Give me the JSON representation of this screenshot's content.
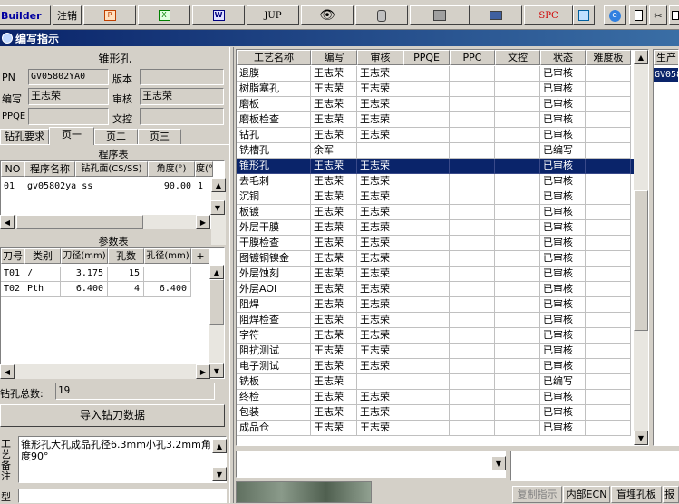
{
  "toolbar": {
    "builder_label": "Builder",
    "cancel_label": "注销",
    "jup_label": "JUP",
    "spc_label": "SPC"
  },
  "window": {
    "title": "编写指示"
  },
  "left": {
    "section_title": "锥形孔",
    "pn_label": "PN",
    "pn_value": "GV05802YA0",
    "version_label": "版本",
    "version_value": "",
    "writer_label": "编写",
    "writer_value": "王志荣",
    "reviewer_label": "审核",
    "reviewer_value": "王志荣",
    "ppqe_label": "PPQE",
    "ppqe_value": "",
    "doc_label": "文控",
    "doc_value": "",
    "tabs": [
      "钻孔要求",
      "页一",
      "页二",
      "页三"
    ],
    "program_table": {
      "title": "程序表",
      "headers": [
        "NO",
        "程序名称",
        "钻孔面(CS/SS)",
        "角度(°)",
        "度(°"
      ],
      "rows": [
        [
          "01",
          "gv05802ya ss",
          "",
          "90.00",
          "1"
        ]
      ]
    },
    "param_table": {
      "title": "参数表",
      "headers": [
        "刀号",
        "类别",
        "刀径(mm)",
        "孔数",
        "孔径(mm)",
        "+"
      ],
      "rows": [
        [
          "T01",
          "/",
          "3.175",
          "15",
          ""
        ],
        [
          "T02",
          "Pth",
          "6.400",
          "4",
          "6.400"
        ]
      ]
    },
    "total_label": "钻孔总数:",
    "total_value": "19",
    "import_button": "导入钻刀数据",
    "note_label": "工艺备注",
    "note_text": "锥形孔大孔成品孔径6.3mm小孔3.2mm角度90°",
    "type_label": "型"
  },
  "process_table": {
    "headers": [
      "工艺名称",
      "编写",
      "审核",
      "PPQE",
      "PPC",
      "文控",
      "状态",
      "难度板"
    ],
    "selected_index": 6,
    "rows": [
      [
        "退膜",
        "王志荣",
        "王志荣",
        "",
        "",
        "",
        "已审核",
        ""
      ],
      [
        "树脂塞孔",
        "王志荣",
        "王志荣",
        "",
        "",
        "",
        "已审核",
        ""
      ],
      [
        "磨板",
        "王志荣",
        "王志荣",
        "",
        "",
        "",
        "已审核",
        ""
      ],
      [
        "磨板检查",
        "王志荣",
        "王志荣",
        "",
        "",
        "",
        "已审核",
        ""
      ],
      [
        "钻孔",
        "王志荣",
        "王志荣",
        "",
        "",
        "",
        "已审核",
        ""
      ],
      [
        "铣槽孔",
        "余军",
        "",
        "",
        "",
        "",
        "已编写",
        ""
      ],
      [
        "锥形孔",
        "王志荣",
        "王志荣",
        "",
        "",
        "",
        "已审核",
        ""
      ],
      [
        "去毛刺",
        "王志荣",
        "王志荣",
        "",
        "",
        "",
        "已审核",
        ""
      ],
      [
        "沉铜",
        "王志荣",
        "王志荣",
        "",
        "",
        "",
        "已审核",
        ""
      ],
      [
        "板镀",
        "王志荣",
        "王志荣",
        "",
        "",
        "",
        "已审核",
        ""
      ],
      [
        "外层干膜",
        "王志荣",
        "王志荣",
        "",
        "",
        "",
        "已审核",
        ""
      ],
      [
        "干膜检查",
        "王志荣",
        "王志荣",
        "",
        "",
        "",
        "已审核",
        ""
      ],
      [
        "图镀铜镍金",
        "王志荣",
        "王志荣",
        "",
        "",
        "",
        "已审核",
        ""
      ],
      [
        "外层蚀刻",
        "王志荣",
        "王志荣",
        "",
        "",
        "",
        "已审核",
        ""
      ],
      [
        "外层AOI",
        "王志荣",
        "王志荣",
        "",
        "",
        "",
        "已审核",
        ""
      ],
      [
        "阻焊",
        "王志荣",
        "王志荣",
        "",
        "",
        "",
        "已审核",
        ""
      ],
      [
        "阻焊检查",
        "王志荣",
        "王志荣",
        "",
        "",
        "",
        "已审核",
        ""
      ],
      [
        "字符",
        "王志荣",
        "王志荣",
        "",
        "",
        "",
        "已审核",
        ""
      ],
      [
        "阻抗测试",
        "王志荣",
        "王志荣",
        "",
        "",
        "",
        "已审核",
        ""
      ],
      [
        "电子测试",
        "王志荣",
        "王志荣",
        "",
        "",
        "",
        "已审核",
        ""
      ],
      [
        "铣板",
        "王志荣",
        "",
        "",
        "",
        "",
        "已编写",
        ""
      ],
      [
        "终检",
        "王志荣",
        "王志荣",
        "",
        "",
        "",
        "已审核",
        ""
      ],
      [
        "包装",
        "王志荣",
        "王志荣",
        "",
        "",
        "",
        "已审核",
        ""
      ],
      [
        "成品仓",
        "王志荣",
        "王志荣",
        "",
        "",
        "",
        "已审核",
        ""
      ]
    ]
  },
  "right_panel": {
    "header": "生产",
    "value": "GV058"
  },
  "bottom_buttons": [
    "复制指示",
    "内部ECN",
    "盲埋孔板",
    "报"
  ],
  "colors": {
    "selected_bg": "#0a246a",
    "title_bg": "#0a246a",
    "window_bg": "#d4d0c8"
  }
}
